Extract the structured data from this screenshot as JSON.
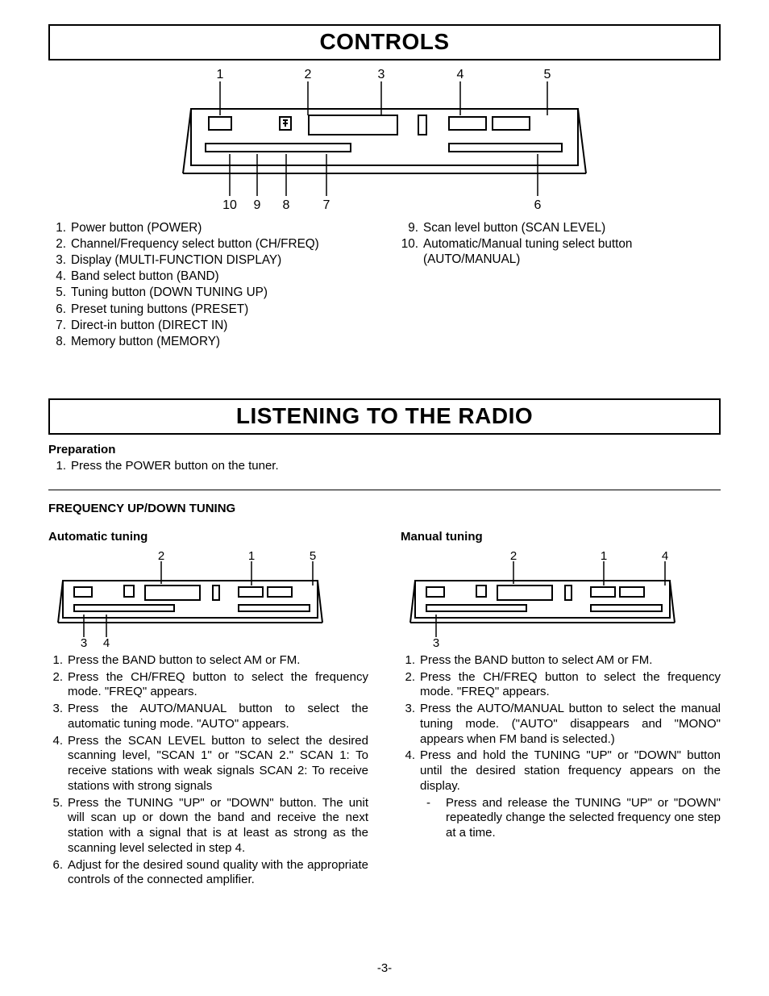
{
  "controls": {
    "title": "CONTROLS",
    "diagram": {
      "top_labels": [
        "1",
        "2",
        "3",
        "4",
        "5"
      ],
      "bottom_labels": [
        "10",
        "9",
        "8",
        "7",
        "6"
      ]
    },
    "left_list": [
      {
        "n": "1.",
        "t": "Power button (POWER)"
      },
      {
        "n": "2.",
        "t": "Channel/Frequency select button (CH/FREQ)"
      },
      {
        "n": "3.",
        "t": "Display (MULTI-FUNCTION DISPLAY)"
      },
      {
        "n": "4.",
        "t": "Band select button (BAND)"
      },
      {
        "n": "5.",
        "t": "Tuning button (DOWN TUNING UP)"
      },
      {
        "n": "6.",
        "t": "Preset tuning buttons (PRESET)"
      },
      {
        "n": "7.",
        "t": "Direct-in button (DIRECT IN)"
      },
      {
        "n": "8.",
        "t": "Memory button (MEMORY)"
      }
    ],
    "right_list": [
      {
        "n": "9.",
        "t": "Scan level button (SCAN LEVEL)"
      },
      {
        "n": "10.",
        "t": "Automatic/Manual tuning select button (AUTO/MANUAL)"
      }
    ]
  },
  "listening": {
    "title": "LISTENING TO THE RADIO",
    "prep_heading": "Preparation",
    "prep_step": {
      "n": "1.",
      "t": "Press the POWER button on the tuner."
    },
    "freq_heading": "FREQUENCY UP/DOWN TUNING",
    "auto": {
      "heading": "Automatic tuning",
      "diagram": {
        "top_labels": [
          "2",
          "1",
          "5"
        ],
        "bottom_labels": [
          "3",
          "4"
        ]
      },
      "steps": [
        {
          "n": "1.",
          "t": "Press the BAND button to select AM or FM."
        },
        {
          "n": "2.",
          "t": "Press the CH/FREQ button to select the frequency mode. \"FREQ\" appears."
        },
        {
          "n": "3.",
          "t": "Press the AUTO/MANUAL button to select the automatic tuning mode. \"AUTO\" appears."
        },
        {
          "n": "4.",
          "t": "Press the SCAN LEVEL button to select the desired scanning level, \"SCAN 1\" or \"SCAN 2.\"\nSCAN 1: To receive stations with weak signals\nSCAN 2: To receive stations with strong signals"
        },
        {
          "n": "5.",
          "t": "Press the TUNING \"UP\" or \"DOWN\" button.\nThe unit will scan up or down the band and receive the next station with a signal that is at least as strong as the scanning level selected in step 4."
        },
        {
          "n": "6.",
          "t": "Adjust for the desired sound quality with the appropriate controls of the connected amplifier."
        }
      ]
    },
    "manual": {
      "heading": "Manual tuning",
      "diagram": {
        "top_labels": [
          "2",
          "1",
          "4"
        ],
        "bottom_labels": [
          "3"
        ]
      },
      "steps": [
        {
          "n": "1.",
          "t": "Press the BAND button to select AM or FM."
        },
        {
          "n": "2.",
          "t": "Press the CH/FREQ button to select the frequency mode. \"FREQ\" appears."
        },
        {
          "n": "3.",
          "t": "Press the AUTO/MANUAL button to select the manual tuning mode. (\"AUTO\" disappears and \"MONO\" appears when FM band is selected.)"
        },
        {
          "n": "4.",
          "t": "Press and hold the TUNING \"UP\" or \"DOWN\" button until the desired station frequency appears on the display.",
          "sub": "Press and release the TUNING \"UP\" or \"DOWN\" repeatedly change the selected frequency one step at a time."
        }
      ]
    }
  },
  "page_number": "-3-"
}
